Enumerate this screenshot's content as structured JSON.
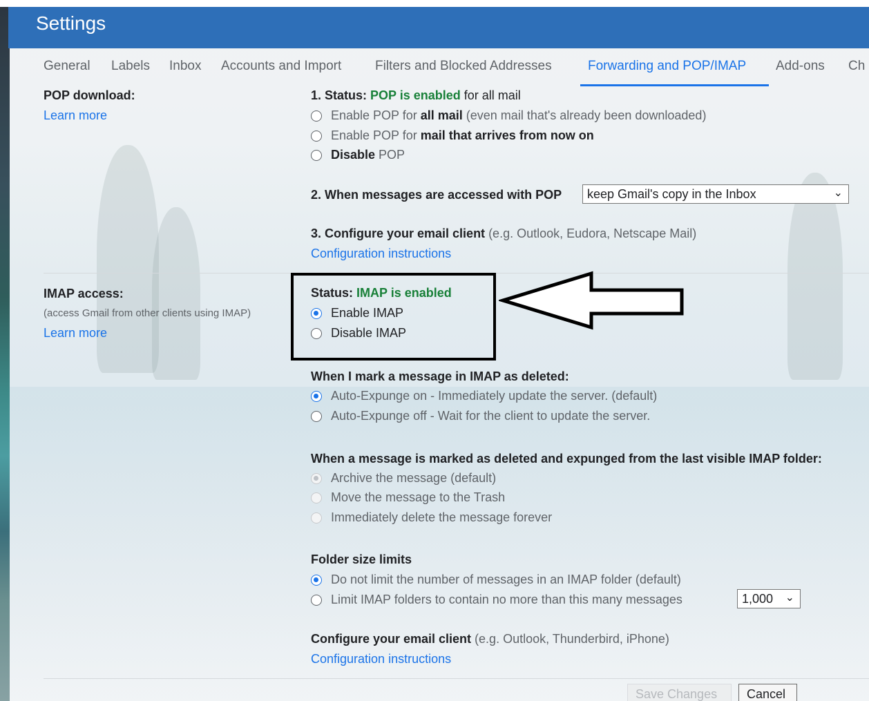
{
  "header": {
    "title": "Settings"
  },
  "tabs": [
    {
      "label": "General",
      "active": false
    },
    {
      "label": "Labels",
      "active": false
    },
    {
      "label": "Inbox",
      "active": false
    },
    {
      "label": "Accounts and Import",
      "active": false
    },
    {
      "label": "Filters and Blocked Addresses",
      "active": false
    },
    {
      "label": "Forwarding and POP/IMAP",
      "active": true
    },
    {
      "label": "Add-ons",
      "active": false
    },
    {
      "label": "Ch",
      "active": false
    }
  ],
  "pop": {
    "heading": "POP download:",
    "learn_more": "Learn more",
    "status_prefix": "1. Status: ",
    "status_value": "POP is enabled",
    "status_suffix": " for all mail",
    "options": [
      {
        "pre": "Enable POP for ",
        "bold": "all mail",
        "post": " (even mail that's already been downloaded)",
        "checked": false
      },
      {
        "pre": "Enable POP for ",
        "bold": "mail that arrives from now on",
        "post": "",
        "checked": false
      },
      {
        "pre": "",
        "bold": "Disable",
        "post": " POP",
        "checked": false
      }
    ],
    "access_label": "2. When messages are accessed with POP",
    "access_select": "keep Gmail's copy in the Inbox",
    "configure_bold": "3. Configure your email client",
    "configure_rest": " (e.g. Outlook, Eudora, Netscape Mail)",
    "config_link": "Configuration instructions"
  },
  "imap": {
    "heading": "IMAP access:",
    "description": "(access Gmail from other clients using IMAP)",
    "learn_more": "Learn more",
    "status_prefix": "Status: ",
    "status_value": "IMAP is enabled",
    "options": [
      {
        "label": "Enable IMAP",
        "checked": true
      },
      {
        "label": "Disable IMAP",
        "checked": false
      }
    ],
    "deleted_heading": "When I mark a message in IMAP as deleted:",
    "deleted_options": [
      {
        "label": "Auto-Expunge on - Immediately update the server. (default)",
        "checked": true
      },
      {
        "label": "Auto-Expunge off - Wait for the client to update the server.",
        "checked": false
      }
    ],
    "expunged_heading": "When a message is marked as deleted and expunged from the last visible IMAP folder:",
    "expunged_options": [
      {
        "label": "Archive the message (default)",
        "checked": true,
        "disabled": true
      },
      {
        "label": "Move the message to the Trash",
        "checked": false,
        "disabled": true
      },
      {
        "label": "Immediately delete the message forever",
        "checked": false,
        "disabled": true
      }
    ],
    "folder_heading": "Folder size limits",
    "folder_options": [
      {
        "label": "Do not limit the number of messages in an IMAP folder (default)",
        "checked": true
      },
      {
        "label": "Limit IMAP folders to contain no more than this many messages",
        "checked": false
      }
    ],
    "folder_limit_select": "1,000",
    "configure_bold": "Configure your email client",
    "configure_rest": " (e.g. Outlook, Thunderbird, iPhone)",
    "config_link": "Configuration instructions"
  },
  "footer": {
    "save_label": "Save Changes",
    "cancel_label": "Cancel"
  },
  "colors": {
    "header": "#2e6fb8",
    "accent": "#1a73e8",
    "status_green": "#188038",
    "annotation": "#000000"
  },
  "icons": {
    "select_arrow": "chevron-down-icon",
    "annotation_arrow": "arrow-left-icon"
  }
}
